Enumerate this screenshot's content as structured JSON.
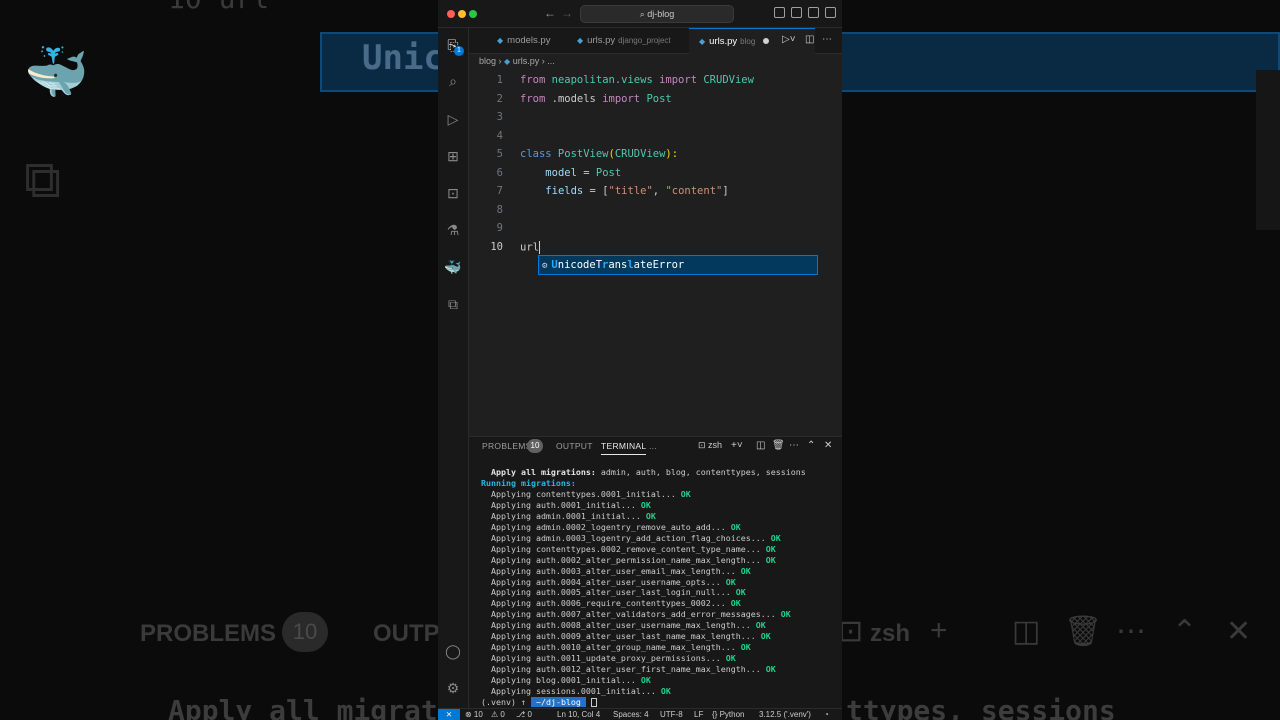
{
  "background": {
    "code_line": "10   url",
    "suggest_text": "Unic",
    "problems_label": "PROBLEMS",
    "problems_count": "10",
    "output_label": "OUTPU",
    "shell_label": "zsh",
    "bottom_left": "Apply all migrat",
    "bottom_right": "ttypes, sessions"
  },
  "titlebar": {
    "search": "dj-blog"
  },
  "activity": {
    "explorer_badge": "1"
  },
  "tabs": [
    {
      "label": "models.py",
      "desc": ""
    },
    {
      "label": "urls.py",
      "desc": "django_project"
    },
    {
      "label": "urls.py",
      "desc": "blog"
    }
  ],
  "breadcrumb": {
    "folder": "blog",
    "file": "urls.py",
    "more": "..."
  },
  "editor": {
    "line_numbers": [
      "1",
      "2",
      "3",
      "4",
      "5",
      "6",
      "7",
      "8",
      "9",
      "10"
    ],
    "typed": "url",
    "suggestion": {
      "match_start": "U",
      "middle": "nicode",
      "t": "T",
      "r": "r",
      "a": "ans",
      "l": "l",
      "rest": "ateError"
    }
  },
  "code": {
    "l1": {
      "kw1": "from",
      "mod": " neapolitan.views ",
      "kw2": "import",
      "cls": " CRUDView"
    },
    "l2": {
      "kw1": "from",
      "mod": " .models ",
      "kw2": "import",
      "cls": " Post"
    },
    "l5": {
      "kw": "class",
      "name": " PostView",
      "p1": "(",
      "base": "CRUDView",
      "p2": "):"
    },
    "l6": {
      "indent": "    ",
      "var": "model",
      "eq": " = ",
      "cls": "Post"
    },
    "l7": {
      "indent": "    ",
      "var": "fields",
      "eq": " = [",
      "s1": "\"title\"",
      "comma": ", ",
      "s2": "\"content\"",
      "end": "]"
    }
  },
  "panel": {
    "tabs": [
      "PROBLEMS",
      "OUTPUT",
      "TERMINAL",
      "..."
    ],
    "problems_count": "10",
    "shell": "zsh",
    "terminal": {
      "header_bold": "  Apply all migrations:",
      "header_rest": " admin, auth, blog, contenttypes, sessions",
      "running": "Running migrations:",
      "lines": [
        "  Applying contenttypes.0001_initial...",
        "  Applying auth.0001_initial...",
        "  Applying admin.0001_initial...",
        "  Applying admin.0002_logentry_remove_auto_add...",
        "  Applying admin.0003_logentry_add_action_flag_choices...",
        "  Applying contenttypes.0002_remove_content_type_name...",
        "  Applying auth.0002_alter_permission_name_max_length...",
        "  Applying auth.0003_alter_user_email_max_length...",
        "  Applying auth.0004_alter_user_username_opts...",
        "  Applying auth.0005_alter_user_last_login_null...",
        "  Applying auth.0006_require_contenttypes_0002...",
        "  Applying auth.0007_alter_validators_add_error_messages...",
        "  Applying auth.0008_alter_user_username_max_length...",
        "  Applying auth.0009_alter_user_last_name_max_length...",
        "  Applying auth.0010_alter_group_name_max_length...",
        "  Applying auth.0011_update_proxy_permissions...",
        "  Applying auth.0012_alter_user_first_name_max_length...",
        "  Applying blog.0001_initial...",
        "  Applying sessions.0001_initial..."
      ],
      "ok": " OK",
      "prompt_env": "(.venv)",
      "prompt_arrow": "↑",
      "prompt_dir": " ~/dj-blog "
    }
  },
  "status": {
    "errors": "⊗ 10",
    "warnings": "⚠ 0",
    "ports": "⎇ 0",
    "position": "Ln 10, Col 4",
    "spaces": "Spaces: 4",
    "encoding": "UTF-8",
    "eol": "LF",
    "language": "{} Python",
    "interpreter": "3.12.5 ('.venv')",
    "bell": "🔔"
  }
}
